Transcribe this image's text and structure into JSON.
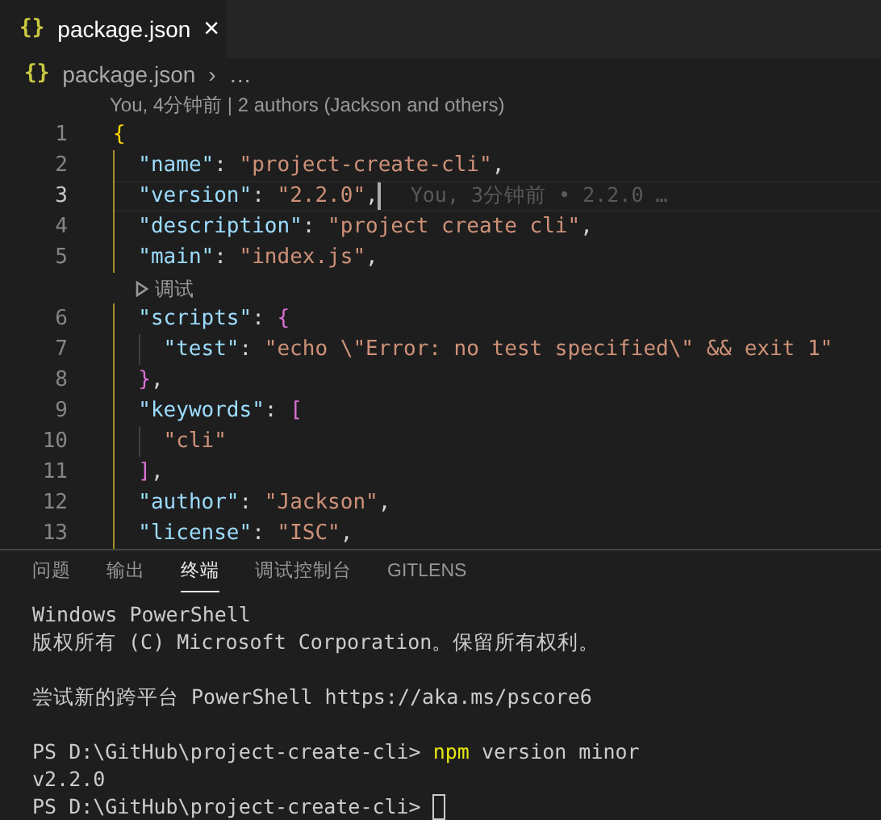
{
  "editor_tab": {
    "icon": "{}",
    "label": "package.json",
    "close": "×",
    "selected": true
  },
  "breadcrumb": {
    "icon": "{}",
    "file": "package.json",
    "separator": "›",
    "more": "…"
  },
  "blame_header": "You, 4分钟前 | 2 authors (Jackson and others)",
  "rows": [
    {
      "kind": "code",
      "number": "1",
      "current": false,
      "tokens": [
        {
          "kind": "brace1",
          "text": "{"
        }
      ]
    },
    {
      "kind": "code",
      "number": "2",
      "current": false,
      "tokens": [
        {
          "kind": "indent"
        },
        {
          "kind": "key",
          "text": "\"name\""
        },
        {
          "kind": "punct",
          "text": ": "
        },
        {
          "kind": "string",
          "text": "\"project-create-cli\""
        },
        {
          "kind": "punct",
          "text": ","
        }
      ]
    },
    {
      "kind": "code",
      "number": "3",
      "current": true,
      "blame": "You, 3分钟前 • 2.2.0 …",
      "tokens": [
        {
          "kind": "indent"
        },
        {
          "kind": "key",
          "text": "\"version\""
        },
        {
          "kind": "punct",
          "text": ": "
        },
        {
          "kind": "string",
          "text": "\"2.2.0\""
        },
        {
          "kind": "punct",
          "text": ","
        }
      ]
    },
    {
      "kind": "code",
      "number": "4",
      "current": false,
      "tokens": [
        {
          "kind": "indent"
        },
        {
          "kind": "key",
          "text": "\"description\""
        },
        {
          "kind": "punct",
          "text": ": "
        },
        {
          "kind": "string",
          "text": "\"project create cli\""
        },
        {
          "kind": "punct",
          "text": ","
        }
      ]
    },
    {
      "kind": "code",
      "number": "5",
      "current": false,
      "tokens": [
        {
          "kind": "indent"
        },
        {
          "kind": "key",
          "text": "\"main\""
        },
        {
          "kind": "punct",
          "text": ": "
        },
        {
          "kind": "string",
          "text": "\"index.js\""
        },
        {
          "kind": "punct",
          "text": ","
        }
      ]
    },
    {
      "kind": "codelens",
      "label": "调试"
    },
    {
      "kind": "code",
      "number": "6",
      "current": false,
      "tokens": [
        {
          "kind": "indent"
        },
        {
          "kind": "key",
          "text": "\"scripts\""
        },
        {
          "kind": "punct",
          "text": ": "
        },
        {
          "kind": "brace2",
          "text": "{"
        }
      ]
    },
    {
      "kind": "code",
      "number": "7",
      "current": false,
      "tokens": [
        {
          "kind": "indent"
        },
        {
          "kind": "indent"
        },
        {
          "kind": "key",
          "text": "\"test\""
        },
        {
          "kind": "punct",
          "text": ": "
        },
        {
          "kind": "string",
          "text": "\"echo \\\"Error: no test specified\\\" && exit 1\""
        }
      ]
    },
    {
      "kind": "code",
      "number": "8",
      "current": false,
      "tokens": [
        {
          "kind": "indent"
        },
        {
          "kind": "brace2",
          "text": "}"
        },
        {
          "kind": "punct",
          "text": ","
        }
      ]
    },
    {
      "kind": "code",
      "number": "9",
      "current": false,
      "tokens": [
        {
          "kind": "indent"
        },
        {
          "kind": "key",
          "text": "\"keywords\""
        },
        {
          "kind": "punct",
          "text": ": "
        },
        {
          "kind": "brace2",
          "text": "["
        }
      ]
    },
    {
      "kind": "code",
      "number": "10",
      "current": false,
      "tokens": [
        {
          "kind": "indent"
        },
        {
          "kind": "indent"
        },
        {
          "kind": "string",
          "text": "\"cli\""
        }
      ]
    },
    {
      "kind": "code",
      "number": "11",
      "current": false,
      "tokens": [
        {
          "kind": "indent"
        },
        {
          "kind": "brace2",
          "text": "]"
        },
        {
          "kind": "punct",
          "text": ","
        }
      ]
    },
    {
      "kind": "code",
      "number": "12",
      "current": false,
      "tokens": [
        {
          "kind": "indent"
        },
        {
          "kind": "key",
          "text": "\"author\""
        },
        {
          "kind": "punct",
          "text": ": "
        },
        {
          "kind": "string",
          "text": "\"Jackson\""
        },
        {
          "kind": "punct",
          "text": ","
        }
      ]
    },
    {
      "kind": "code",
      "number": "13",
      "current": false,
      "tokens": [
        {
          "kind": "indent"
        },
        {
          "kind": "key",
          "text": "\"license\""
        },
        {
          "kind": "punct",
          "text": ": "
        },
        {
          "kind": "string",
          "text": "\"ISC\""
        },
        {
          "kind": "punct",
          "text": ","
        }
      ]
    }
  ],
  "panel_tabs": [
    {
      "label": "问题",
      "selected": false
    },
    {
      "label": "输出",
      "selected": false
    },
    {
      "label": "终端",
      "selected": true
    },
    {
      "label": "调试控制台",
      "selected": false
    },
    {
      "label": "GITLENS",
      "selected": false
    }
  ],
  "terminal_blocks": [
    [
      {
        "segments": [
          {
            "kind": "output",
            "text": "Windows PowerShell"
          }
        ]
      },
      {
        "segments": [
          {
            "kind": "output",
            "text": "版权所有 (C) Microsoft Corporation。保留所有权利。"
          }
        ]
      }
    ],
    [
      {
        "segments": [
          {
            "kind": "output",
            "text": "尝试新的跨平台 PowerShell https://aka.ms/pscore6"
          }
        ]
      }
    ],
    [
      {
        "segments": [
          {
            "kind": "prompt",
            "text": "PS D:\\GitHub\\project-create-cli> "
          },
          {
            "kind": "command",
            "text": "npm"
          },
          {
            "kind": "output",
            "text": " version minor"
          }
        ]
      },
      {
        "segments": [
          {
            "kind": "output",
            "text": "v2.2.0"
          }
        ]
      },
      {
        "cursor": true,
        "segments": [
          {
            "kind": "prompt",
            "text": "PS D:\\GitHub\\project-create-cli> "
          }
        ]
      }
    ]
  ]
}
